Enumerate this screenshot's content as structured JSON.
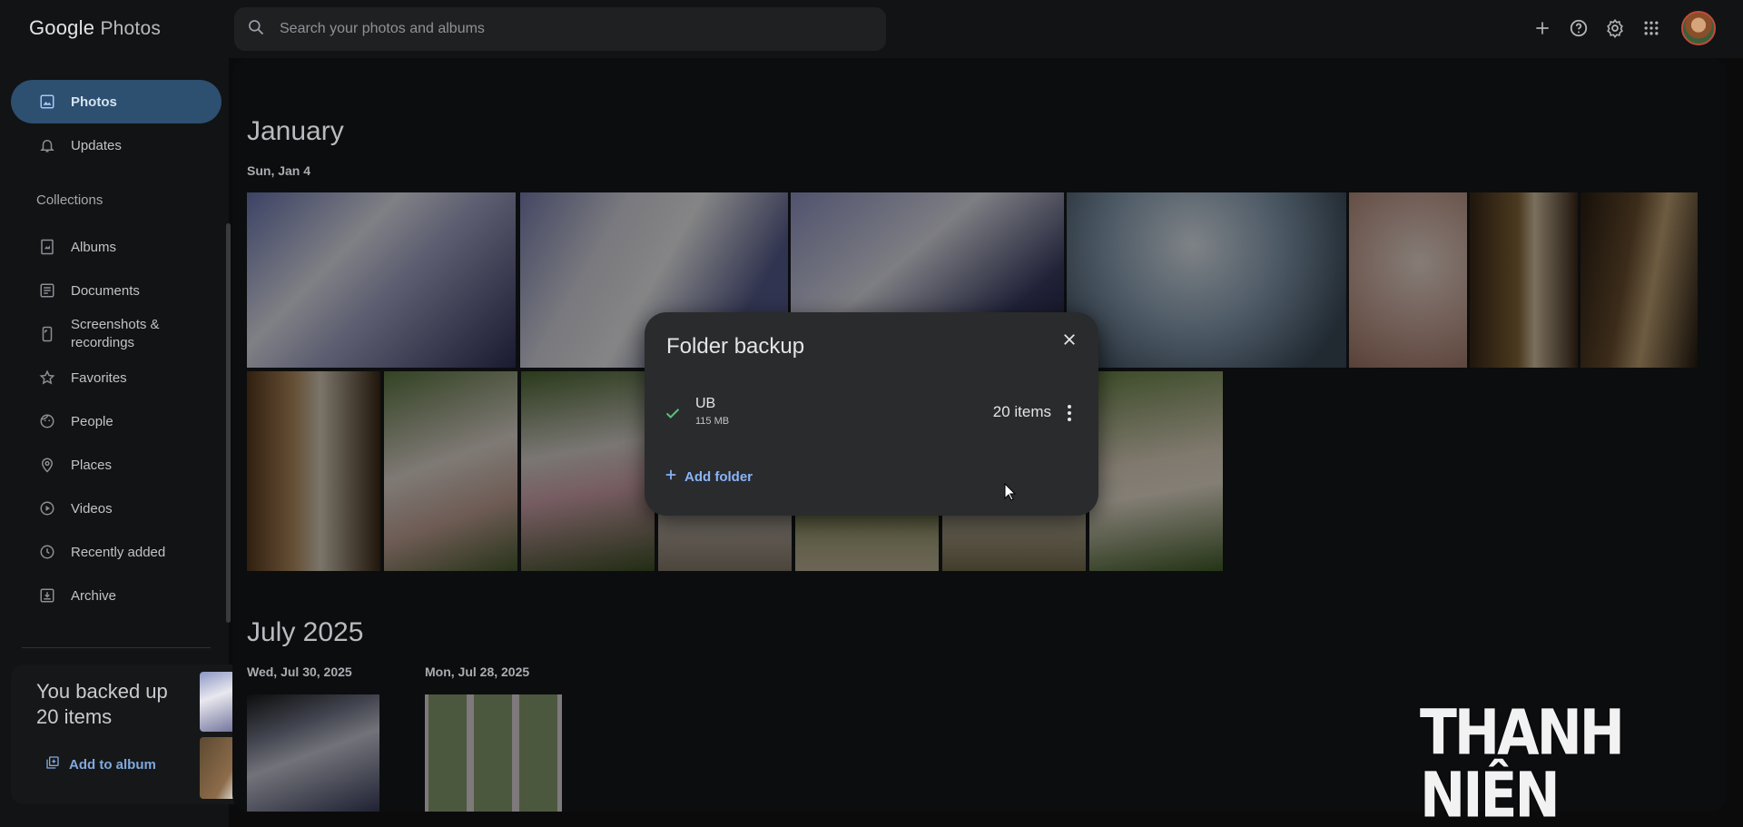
{
  "app": {
    "logo_google": "Google",
    "logo_photos": "Photos"
  },
  "search": {
    "placeholder": "Search your photos and albums"
  },
  "header_icons": [
    "add-icon",
    "help-icon",
    "settings-icon",
    "apps-icon"
  ],
  "sidebar": {
    "items": [
      {
        "label": "Photos",
        "icon": "photo-icon",
        "active": true
      },
      {
        "label": "Updates",
        "icon": "bell-icon"
      }
    ],
    "collections_label": "Collections",
    "collections": [
      {
        "label": "Albums",
        "icon": "album-icon"
      },
      {
        "label": "Documents",
        "icon": "document-icon"
      },
      {
        "label": "Screenshots & recordings",
        "icon": "screenshot-icon"
      },
      {
        "label": "Favorites",
        "icon": "star-icon"
      },
      {
        "label": "People",
        "icon": "face-icon"
      },
      {
        "label": "Places",
        "icon": "pin-icon"
      },
      {
        "label": "Videos",
        "icon": "play-icon"
      },
      {
        "label": "Recently added",
        "icon": "clock-icon"
      },
      {
        "label": "Archive",
        "icon": "archive-icon"
      }
    ]
  },
  "toast": {
    "title": "You backed up 20 items",
    "action": "Add to album"
  },
  "timeline": {
    "sections": [
      {
        "month": "January",
        "days": [
          {
            "label": "Sun, Jan 4"
          }
        ]
      },
      {
        "month": "July 2025",
        "days": [
          {
            "label": "Wed, Jul 30, 2025"
          },
          {
            "label": "Mon, Jul 28, 2025"
          }
        ]
      }
    ]
  },
  "dialog": {
    "title": "Folder backup",
    "folder": {
      "name": "UB",
      "size": "115 MB",
      "count": "20 items"
    },
    "add_folder": "Add folder"
  },
  "watermark": "THANH NIÊN",
  "colors": {
    "accent": "#8ab4f8",
    "active_nav": "#2d4f70",
    "check": "#5fbf77",
    "dialog_bg": "#2a2b2d"
  }
}
